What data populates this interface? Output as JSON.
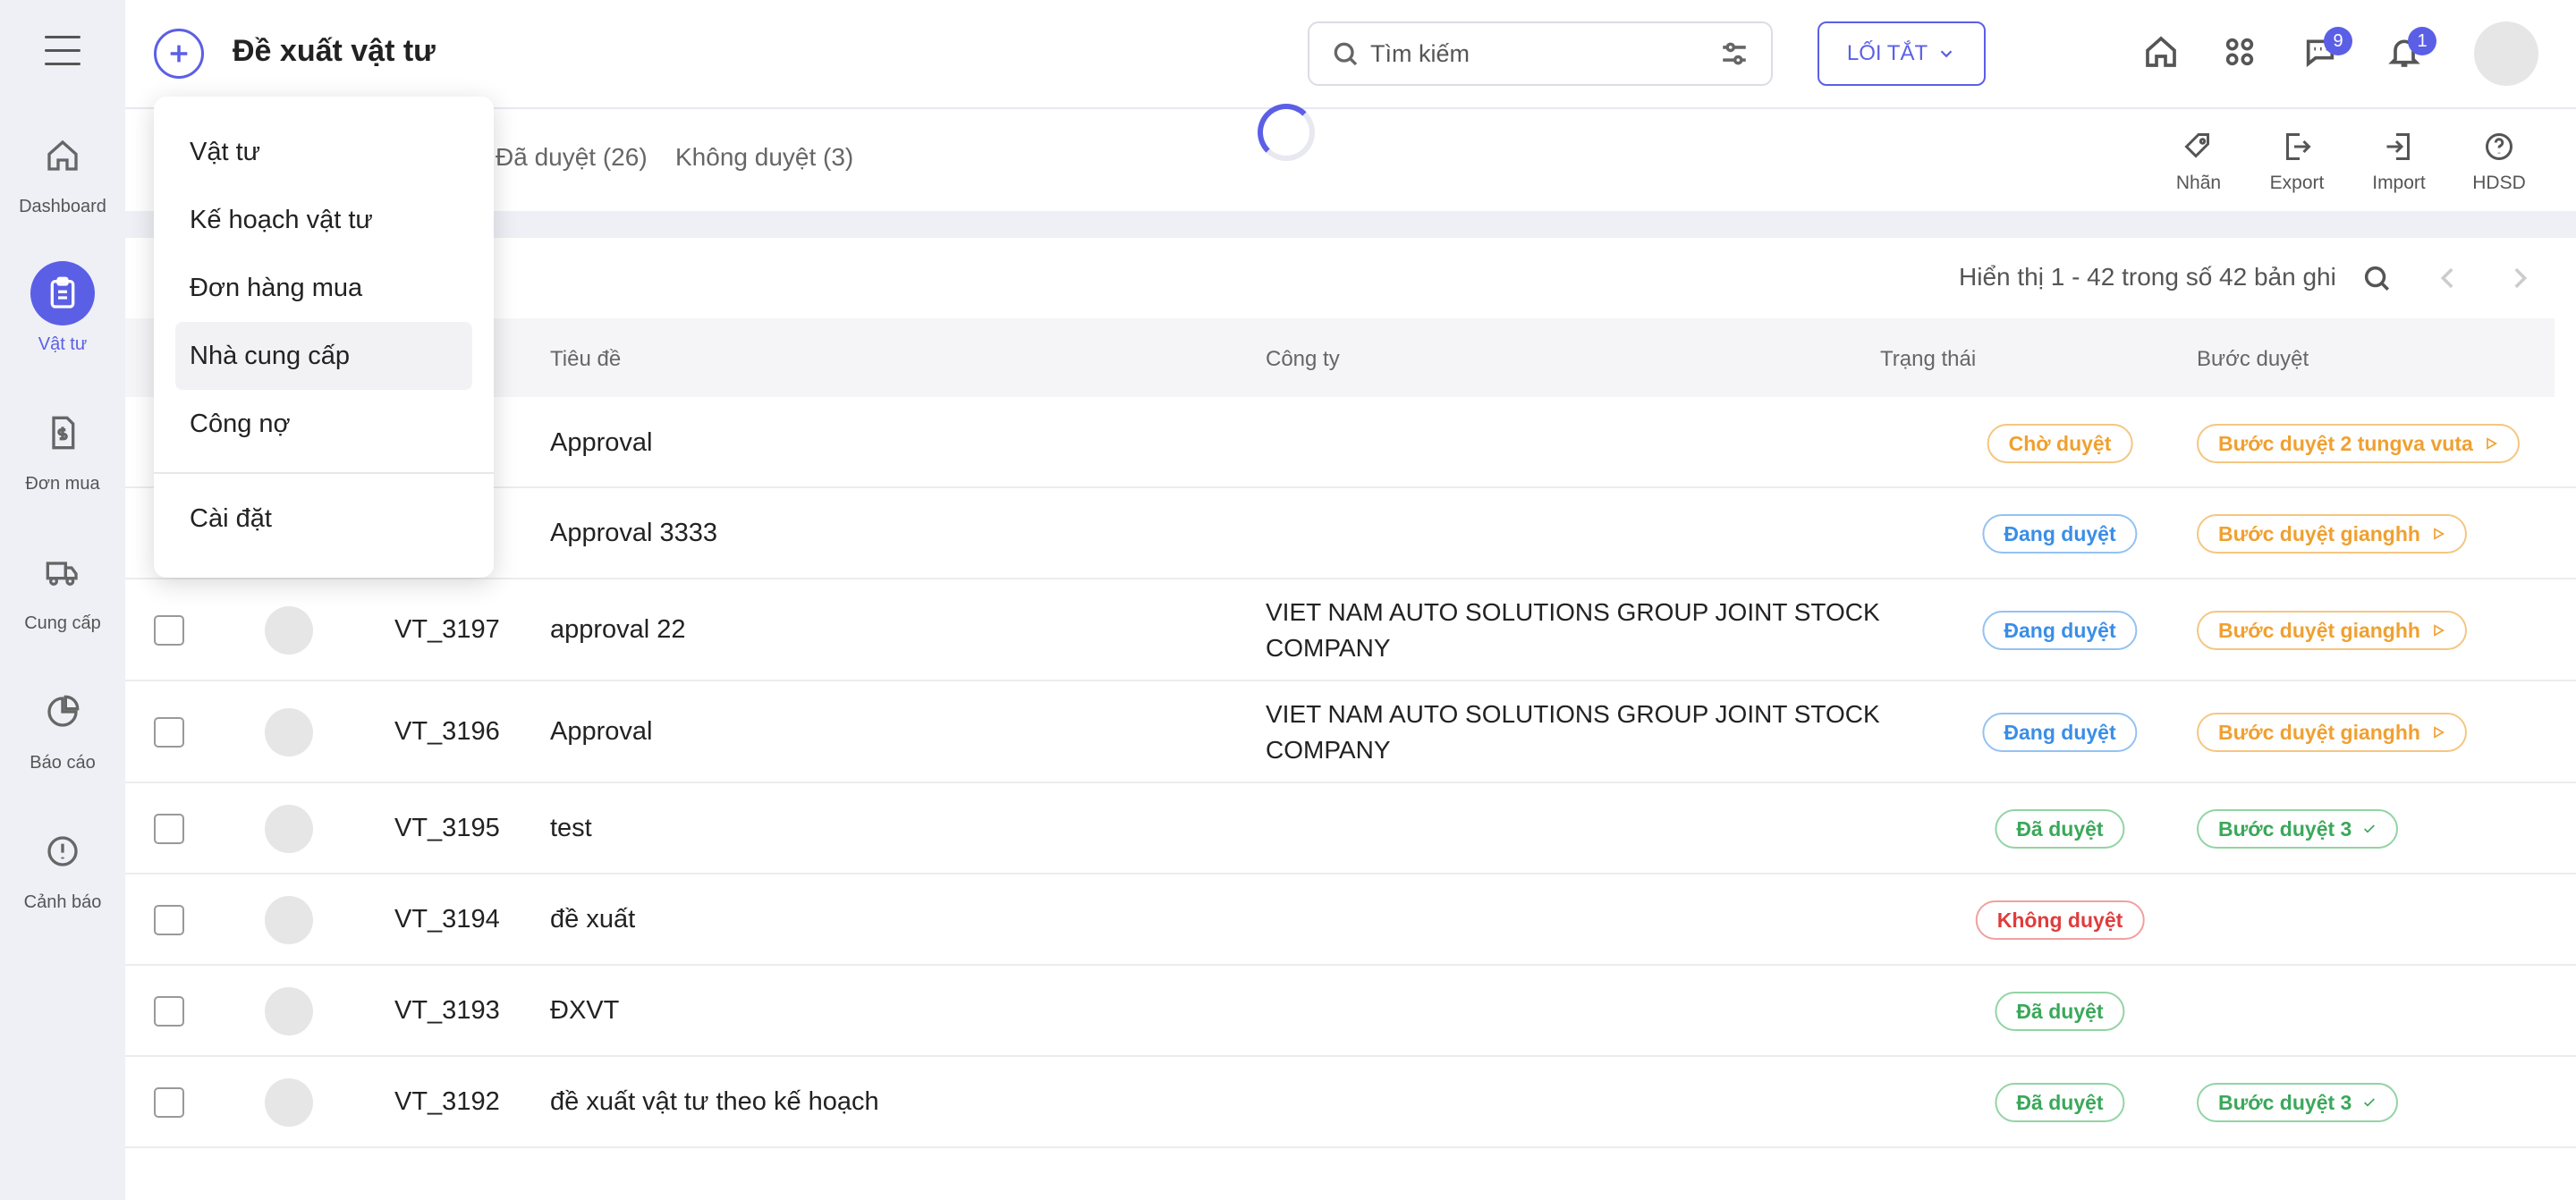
{
  "app": {
    "title": "Đề xuất vật tư"
  },
  "sidebar": {
    "items": [
      {
        "label": "Dashboard",
        "icon": "home-icon"
      },
      {
        "label": "Vật tư",
        "icon": "clipboard-icon"
      },
      {
        "label": "Đơn mua",
        "icon": "invoice-icon"
      },
      {
        "label": "Cung cấp",
        "icon": "truck-icon"
      },
      {
        "label": "Báo cáo",
        "icon": "pie-chart-icon"
      },
      {
        "label": "Cảnh báo",
        "icon": "alert-icon"
      }
    ],
    "active_label": "Vật tư"
  },
  "header": {
    "search_placeholder": "Tìm kiếm",
    "shortcut_label": "LỐI TẮT",
    "chat_badge": "9",
    "notification_badge": "1"
  },
  "tabs": [
    {
      "label": "Đã duyệt (26)"
    },
    {
      "label": "Không duyệt (3)"
    }
  ],
  "toolbar": {
    "tag_label": "Nhãn",
    "export_label": "Export",
    "import_label": "Import",
    "help_label": "HDSD"
  },
  "pagination": {
    "text": "Hiển thị 1 - 42 trong số 42 bản ghi"
  },
  "table": {
    "headers": {
      "title": "Tiêu đề",
      "company": "Công ty",
      "status": "Trạng thái",
      "step": "Bước duyệt"
    },
    "rows": [
      {
        "code": "",
        "title": "Approval",
        "company": "",
        "status": "Chờ duyệt",
        "status_color": "orange",
        "step": "Bước duyệt 2 tungva vuta",
        "step_color": "orange"
      },
      {
        "code": "",
        "title": "Approval 3333",
        "company": "",
        "status": "Đang duyệt",
        "status_color": "blue",
        "step": "Bước duyệt gianghh",
        "step_color": "orange"
      },
      {
        "code": "VT_3197",
        "title": "approval 22",
        "company": "VIET NAM AUTO SOLUTIONS GROUP JOINT STOCK COMPANY",
        "status": "Đang duyệt",
        "status_color": "blue",
        "step": "Bước duyệt gianghh",
        "step_color": "orange"
      },
      {
        "code": "VT_3196",
        "title": "Approval",
        "company": "VIET NAM AUTO SOLUTIONS GROUP JOINT STOCK COMPANY",
        "status": "Đang duyệt",
        "status_color": "blue",
        "step": "Bước duyệt gianghh",
        "step_color": "orange"
      },
      {
        "code": "VT_3195",
        "title": "test",
        "company": "",
        "status": "Đã duyệt",
        "status_color": "green",
        "step": "Bước duyệt 3",
        "step_color": "green"
      },
      {
        "code": "VT_3194",
        "title": "đề xuất",
        "company": "",
        "status": "Không duyệt",
        "status_color": "red",
        "step": "",
        "step_color": ""
      },
      {
        "code": "VT_3193",
        "title": "ĐXVT",
        "company": "",
        "status": "Đã duyệt",
        "status_color": "green",
        "step": "",
        "step_color": ""
      },
      {
        "code": "VT_3192",
        "title": "đề xuất vật tư theo kế hoạch",
        "company": "",
        "status": "Đã duyệt",
        "status_color": "green",
        "step": "Bước duyệt 3",
        "step_color": "green"
      }
    ]
  },
  "dropdown": {
    "items": [
      {
        "label": "Vật tư"
      },
      {
        "label": "Kế hoạch vật tư"
      },
      {
        "label": "Đơn hàng mua"
      },
      {
        "label": "Nhà cung cấp"
      },
      {
        "label": "Công nợ"
      },
      {
        "label": "Cài đặt"
      }
    ],
    "hovered": "Nhà cung cấp"
  },
  "colors": {
    "accent": "#5b5fe6",
    "orange": "#f0a030",
    "blue": "#3a8ee6",
    "green": "#3aa85a",
    "red": "#e03c3c"
  }
}
